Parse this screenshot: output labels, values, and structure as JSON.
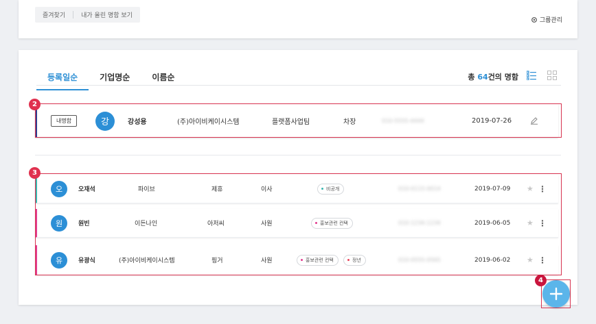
{
  "top_bar": {
    "filters": [
      "즐겨찾기",
      "내가 올린 명함 보기"
    ],
    "group_manage_label": "그룹관리",
    "group_manage_icon": "gear-icon"
  },
  "tabs": [
    {
      "label": "등록일순",
      "active": true
    },
    {
      "label": "기업명순",
      "active": false
    },
    {
      "label": "이름순",
      "active": false
    }
  ],
  "summary": {
    "prefix": "총 ",
    "count": "64",
    "suffix": "건의 명함"
  },
  "view_icons": [
    "list-view-icon",
    "grid-view-icon"
  ],
  "my_card": {
    "badge": "내명함",
    "avatar": "강",
    "name": "강성용",
    "company": "(주)아이비케이시스템",
    "department": "플랫폼사업팀",
    "title": "차장",
    "phone": "010-5555-4444",
    "date": "2019-07-26",
    "edit_icon": "pencil-icon"
  },
  "cards": [
    {
      "avatar": "오",
      "name": "오재석",
      "company": "파이브",
      "department": "제휴",
      "title": "이사",
      "tags": [
        {
          "label": "비공개",
          "color": "teal"
        }
      ],
      "phone": "010-0115-0014",
      "date": "2019-07-09"
    },
    {
      "avatar": "원",
      "name": "원빈",
      "company": "이든나인",
      "department": "아저씨",
      "title": "사원",
      "tags": [
        {
          "label": "홍보관련 컨택",
          "color": "pink"
        }
      ],
      "phone": "010-1234-1234",
      "date": "2019-06-05"
    },
    {
      "avatar": "유",
      "name": "유광식",
      "company": "(주)아이비케이시스템",
      "department": "핑거",
      "title": "사원",
      "tags": [
        {
          "label": "홍보관련 컨택",
          "color": "pink"
        },
        {
          "label": "정년",
          "color": "red"
        }
      ],
      "phone": "010-0555-0565",
      "date": "2019-06-02"
    }
  ],
  "markers": [
    "2",
    "3",
    "4"
  ],
  "colors": {
    "accent": "#2d8fd5",
    "highlight": "#d7324f",
    "fab": "#5bb5ea"
  }
}
